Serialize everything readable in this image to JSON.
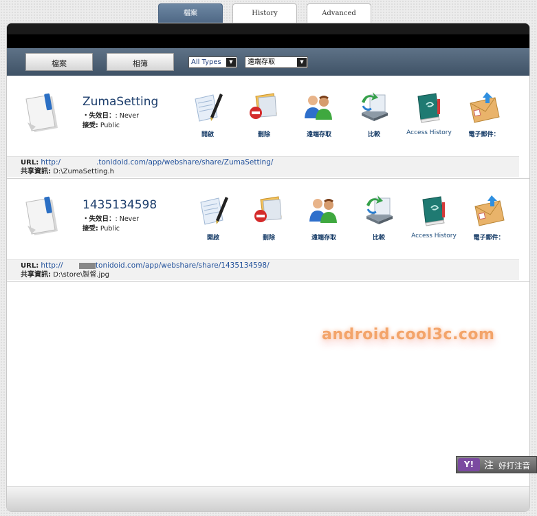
{
  "tabs": [
    {
      "label": "檔案",
      "active": true
    },
    {
      "label": "History",
      "active": false
    },
    {
      "label": "Advanced",
      "active": false
    }
  ],
  "toolbar": {
    "files_button": "檔案",
    "albums_button": "相簿",
    "type_filter": "All Types",
    "access_filter": "遠端存取"
  },
  "actions": {
    "open": "開啟",
    "delete": "刪除",
    "remote_access": "遠端存取",
    "sync": "比較",
    "access_history": "Access History",
    "email": "電子郵件："
  },
  "items": [
    {
      "name": "ZumaSetting",
      "expire_label": "・失效日：",
      "expire_value": ": Never",
      "recipients_label": "接受:",
      "recipients_value": "Public",
      "url_label": "URL:",
      "url_prefix": "http:/",
      "url_rest": ".tonidoid.com/app/webshare/share/ZumaSetting/",
      "path_label": "共享資訊:",
      "path_value": "D:\\ZumaSetting.h"
    },
    {
      "name": "1435134598",
      "expire_label": "・失效日：",
      "expire_value": ": Never",
      "recipients_label": "接受:",
      "recipients_value": "Public",
      "url_label": "URL:",
      "url_prefix": "http://",
      "url_rest": "tonidoid.com/app/webshare/share/1435134598/",
      "path_label": "共享資訊:",
      "path_value": "D:\\store\\製督.jpg"
    }
  ],
  "watermark": "android.cool3c.com",
  "ime": {
    "logo": "Y!",
    "mode": "注",
    "name": "好打注音"
  },
  "colors": {
    "active_tab": "#5a7392",
    "toolbar": "#4a5d72",
    "header": "#000000",
    "link": "#1f4f9a",
    "title": "#1e3f6d",
    "watermark": "#f3a46a"
  }
}
